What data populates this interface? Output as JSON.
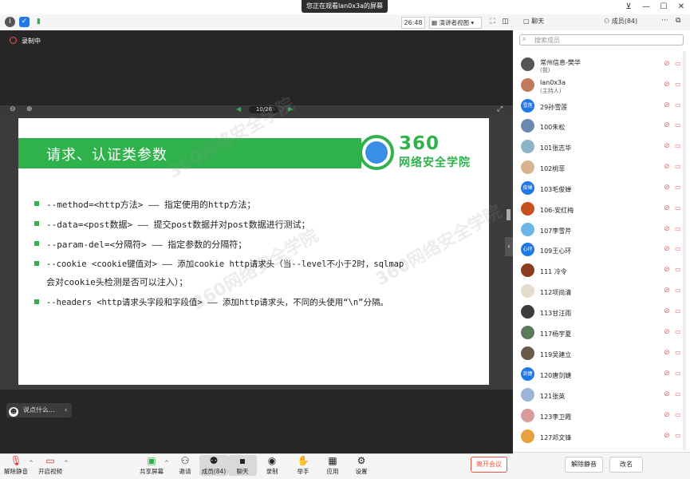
{
  "viewing_banner": "您正在观看lan0x3a的屏幕",
  "toolbar": {
    "timer": "26:48",
    "view_mode": "演讲者视图",
    "chat_tab": "聊天",
    "members_tab": "成员(84)"
  },
  "share": {
    "recording": "录制中",
    "page": "10/26",
    "chat_placeholder": "说点什么..."
  },
  "slide": {
    "title": "请求、认证类参数",
    "logo_num": "360",
    "logo_text": "网络安全学院",
    "watermark": "360网络安全学院",
    "bullets": [
      "--method=<http方法> —— 指定使用的http方法；",
      "--data=<post数据> —— 提交post数据并对post数据进行测试；",
      "--param-del=<分隔符> —— 指定参数的分隔符；",
      "--cookie <cookie键值对> —— 添加cookie http请求头（当--level不小于2时，sqlmap",
      "会对cookie头检测是否可以注入）；",
      "--headers <http请求头字段和字段值> —— 添加http请求头，不同的头使用“\\n”分隔。"
    ]
  },
  "bottom_bar": {
    "unmute": "解除静音",
    "start_video": "开启视频",
    "share_screen": "共享屏幕",
    "invite": "邀请",
    "members": "成员(84)",
    "chat": "聊天",
    "record": "录制",
    "raise_hand": "举手",
    "apps": "应用",
    "settings": "设置",
    "leave": "离开会议"
  },
  "panel": {
    "search_placeholder": "搜索成员",
    "members": [
      {
        "name": "常州信息-樊华",
        "role": "(我)",
        "color": "#555555"
      },
      {
        "name": "lan0x3a",
        "role": "(主持人)",
        "color": "#c07a5a"
      },
      {
        "name": "29孙雪莲",
        "role": "",
        "color": "#1e78e6",
        "badge": "雪莲"
      },
      {
        "name": "100朱松",
        "role": "",
        "color": "#6a88b0"
      },
      {
        "name": "101张志华",
        "role": "",
        "color": "#8cb4c8"
      },
      {
        "name": "102桃菲",
        "role": "",
        "color": "#d8b48c"
      },
      {
        "name": "103毛俊婵",
        "role": "",
        "color": "#1e78e6",
        "badge": "俊婵"
      },
      {
        "name": "106-安红梅",
        "role": "",
        "color": "#c8501e"
      },
      {
        "name": "107李雪芹",
        "role": "",
        "color": "#6ab4e6"
      },
      {
        "name": "109王心环",
        "role": "",
        "color": "#1e78e6",
        "badge": "心环"
      },
      {
        "name": "111 冷令",
        "role": "",
        "color": "#8c3c1e"
      },
      {
        "name": "112项尚清",
        "role": "",
        "color": "#e6dccc"
      },
      {
        "name": "113甘汪雨",
        "role": "",
        "color": "#3c3c3c"
      },
      {
        "name": "117杨宇夏",
        "role": "",
        "color": "#5a7a5a"
      },
      {
        "name": "119吴建立",
        "role": "",
        "color": "#6a5a4a"
      },
      {
        "name": "120唐剑婕",
        "role": "",
        "color": "#1e78e6",
        "badge": "剑婕"
      },
      {
        "name": "121张英",
        "role": "",
        "color": "#9cb4d8"
      },
      {
        "name": "123李卫霞",
        "role": "",
        "color": "#d89c9c"
      },
      {
        "name": "127邓文锋",
        "role": "",
        "color": "#e6a03c"
      }
    ],
    "mute_all": "解除静音",
    "rename": "改名"
  },
  "colors": {
    "accent": "#2fb24c",
    "leave": "#e54b3c",
    "blue": "#1e78e6"
  }
}
